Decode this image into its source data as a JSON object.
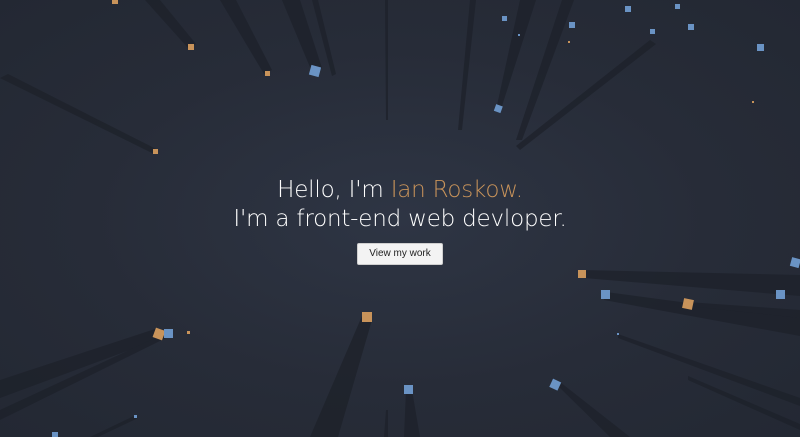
{
  "hero": {
    "line1_prefix": "Hello, I'm ",
    "name": "Ian Roskow.",
    "line2": "I'm a front-end web devloper.",
    "button_label": "View my work"
  },
  "colors": {
    "background": "#272c38",
    "text": "#ffffff",
    "accent": "#c8935a",
    "square_blue": "#6a93c4",
    "square_tan": "#c8935a",
    "button_bg": "#f3f3f3"
  },
  "icons": {
    "background": "particle-burst-animation"
  }
}
